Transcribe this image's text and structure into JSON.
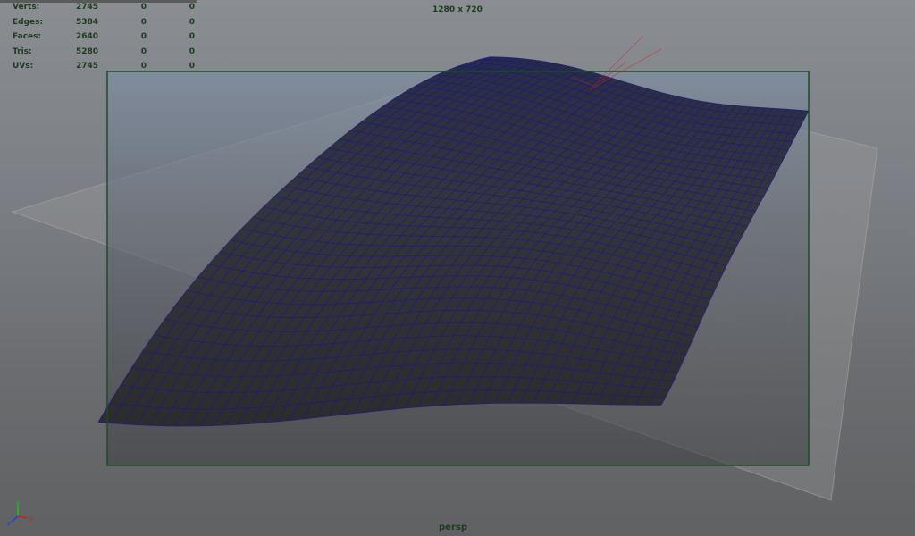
{
  "hud": {
    "rows": [
      {
        "label": "Verts:",
        "v1": "2745",
        "v2": "0",
        "v3": "0"
      },
      {
        "label": "Edges:",
        "v1": "5384",
        "v2": "0",
        "v3": "0"
      },
      {
        "label": "Faces:",
        "v1": "2640",
        "v2": "0",
        "v3": "0"
      },
      {
        "label": "Tris:",
        "v1": "5280",
        "v2": "0",
        "v3": "0"
      },
      {
        "label": "UVs:",
        "v1": "2745",
        "v2": "0",
        "v3": "0"
      }
    ]
  },
  "viewport": {
    "resolution": "1280 x 720",
    "camera": "persp"
  },
  "gizmo": {
    "y": "y",
    "z": "z",
    "x": "x"
  },
  "colors": {
    "hud_text": "#1d3a1d",
    "resolution_gate": "#1d4a2a",
    "wireframe": "#1a1a80",
    "mesh_fill": "#3a3a40",
    "ground_grid": "#8f8f8f",
    "axis_x": "#d02020",
    "axis_y": "#20c020",
    "axis_z": "#2040e0"
  }
}
